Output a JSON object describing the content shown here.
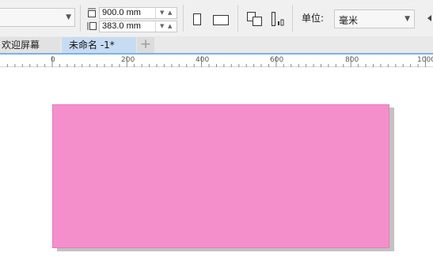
{
  "property_bar": {
    "width_value": "900.0 mm",
    "height_value": "383.0 mm",
    "unit_label": "单位:",
    "unit_value": "毫米"
  },
  "tabs": {
    "items": [
      {
        "label": "欢迎屏幕",
        "active": false
      },
      {
        "label": "未命名 -1*",
        "active": true
      }
    ],
    "add_symbol": "+"
  },
  "ruler": {
    "ticks": [
      "0",
      "200",
      "400",
      "600",
      "800",
      "1000"
    ]
  },
  "canvas": {
    "page_color": "#f58fcc",
    "shadow_color": "#c2c2c2"
  }
}
